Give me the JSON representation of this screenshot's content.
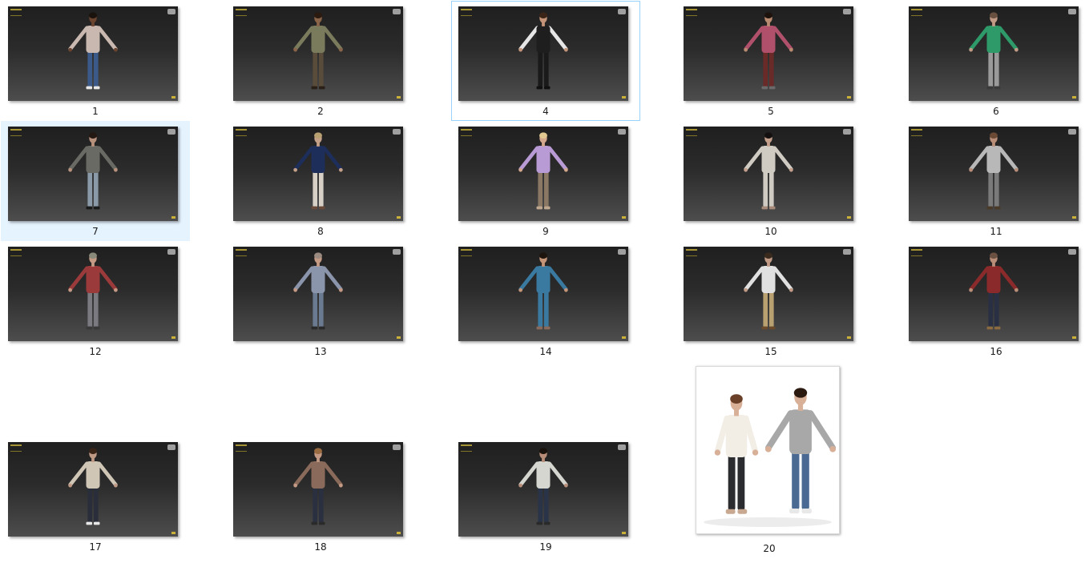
{
  "items": [
    {
      "label": "1",
      "kind": "render",
      "colors": {
        "skin": "#6b4430",
        "top": "#c9b8b0",
        "bottom": "#3b5a8a",
        "shoes": "#e8e8e8",
        "hair": "#1a120c"
      }
    },
    {
      "label": "2",
      "kind": "render",
      "colors": {
        "skin": "#8a6448",
        "top": "#7a7a5c",
        "bottom": "#5a4c3a",
        "shoes": "#2a2018",
        "hair": "#2a1a10"
      }
    },
    {
      "label": "4",
      "kind": "render",
      "state": "focus",
      "colors": {
        "skin": "#c49478",
        "top": "#1e1e1e",
        "bottom": "#1a1a1a",
        "shoes": "#101010",
        "hair": "#3a2418",
        "arms": "#e6e6e6"
      }
    },
    {
      "label": "5",
      "kind": "render",
      "colors": {
        "skin": "#b88a70",
        "top": "#b0506a",
        "bottom": "#6a2a28",
        "shoes": "#6a6a6a",
        "hair": "#1e120c"
      }
    },
    {
      "label": "6",
      "kind": "render",
      "colors": {
        "skin": "#c09a84",
        "top": "#2e9a6a",
        "bottom": "#9a9a9a",
        "shoes": "#3a3a3a",
        "hair": "#6a5040"
      }
    },
    {
      "label": "7",
      "kind": "render",
      "state": "hover",
      "colors": {
        "skin": "#b8917c",
        "top": "#6a6a64",
        "bottom": "#8a9aa8",
        "shoes": "#1a1a1a",
        "hair": "#241812"
      }
    },
    {
      "label": "8",
      "kind": "render",
      "colors": {
        "skin": "#c4a088",
        "top": "#1e2e5a",
        "bottom": "#d6d0c6",
        "shoes": "#6a4a3a",
        "hair": "#b8a070"
      }
    },
    {
      "label": "9",
      "kind": "render",
      "colors": {
        "skin": "#d4a88c",
        "top": "#b89ad4",
        "bottom": "#8a7864",
        "shoes": "#c0a890",
        "hair": "#e0c890"
      }
    },
    {
      "label": "10",
      "kind": "render",
      "colors": {
        "skin": "#c4a08c",
        "top": "#cfcac2",
        "bottom": "#cfcac2",
        "shoes": "#a88a7a",
        "hair": "#141010"
      }
    },
    {
      "label": "11",
      "kind": "render",
      "colors": {
        "skin": "#b88e78",
        "top": "#b8b8b8",
        "bottom": "#7a7a7a",
        "shoes": "#4a3a2a",
        "hair": "#6a4a34"
      }
    },
    {
      "label": "12",
      "kind": "render",
      "colors": {
        "skin": "#c49a84",
        "top": "#9a3a3a",
        "bottom": "#7a7a80",
        "shoes": "#3a3a3a",
        "hair": "#8a8a7a"
      }
    },
    {
      "label": "13",
      "kind": "render",
      "colors": {
        "skin": "#c49a84",
        "top": "#8a94aa",
        "bottom": "#6a7a90",
        "shoes": "#2a2a2a",
        "hair": "#9a8a80"
      }
    },
    {
      "label": "14",
      "kind": "render",
      "colors": {
        "skin": "#c49478",
        "top": "#3a7aa0",
        "bottom": "#3a7aa0",
        "shoes": "#8a6a5a",
        "hair": "#1e140e"
      }
    },
    {
      "label": "15",
      "kind": "render",
      "colors": {
        "skin": "#c09a84",
        "top": "#e0e0e0",
        "bottom": "#b8a070",
        "shoes": "#6a4a2a",
        "hair": "#3a2a1e"
      }
    },
    {
      "label": "16",
      "kind": "render",
      "colors": {
        "skin": "#b88e78",
        "top": "#8a2a2a",
        "bottom": "#2a3044",
        "shoes": "#8a6a40",
        "hair": "#6a5040"
      }
    },
    {
      "label": "17",
      "kind": "render",
      "colors": {
        "skin": "#c09a84",
        "top": "#cfc6b6",
        "bottom": "#2a2e3a",
        "shoes": "#e8e8e8",
        "hair": "#3a2418"
      }
    },
    {
      "label": "18",
      "kind": "render",
      "colors": {
        "skin": "#c49a84",
        "top": "#8a6a5a",
        "bottom": "#2a3040",
        "shoes": "#2a2a2a",
        "hair": "#9a6a40"
      }
    },
    {
      "label": "19",
      "kind": "render",
      "colors": {
        "skin": "#b88e78",
        "top": "#d6d6d0",
        "bottom": "#2a3448",
        "shoes": "#2a2a2a",
        "hair": "#1a120c"
      }
    },
    {
      "label": "20",
      "kind": "photo",
      "colors": {
        "skin": "#d8b098",
        "top": "#f2eee6",
        "bottom": "#2a2c30",
        "shoes": "#c8a890",
        "hair": "#6a4028",
        "skin2": "#d8b098",
        "top2": "#a8a8a8",
        "bottom2": "#4a6a94",
        "shoes2": "#e8e8e8",
        "hair2": "#2a1a10"
      }
    }
  ]
}
